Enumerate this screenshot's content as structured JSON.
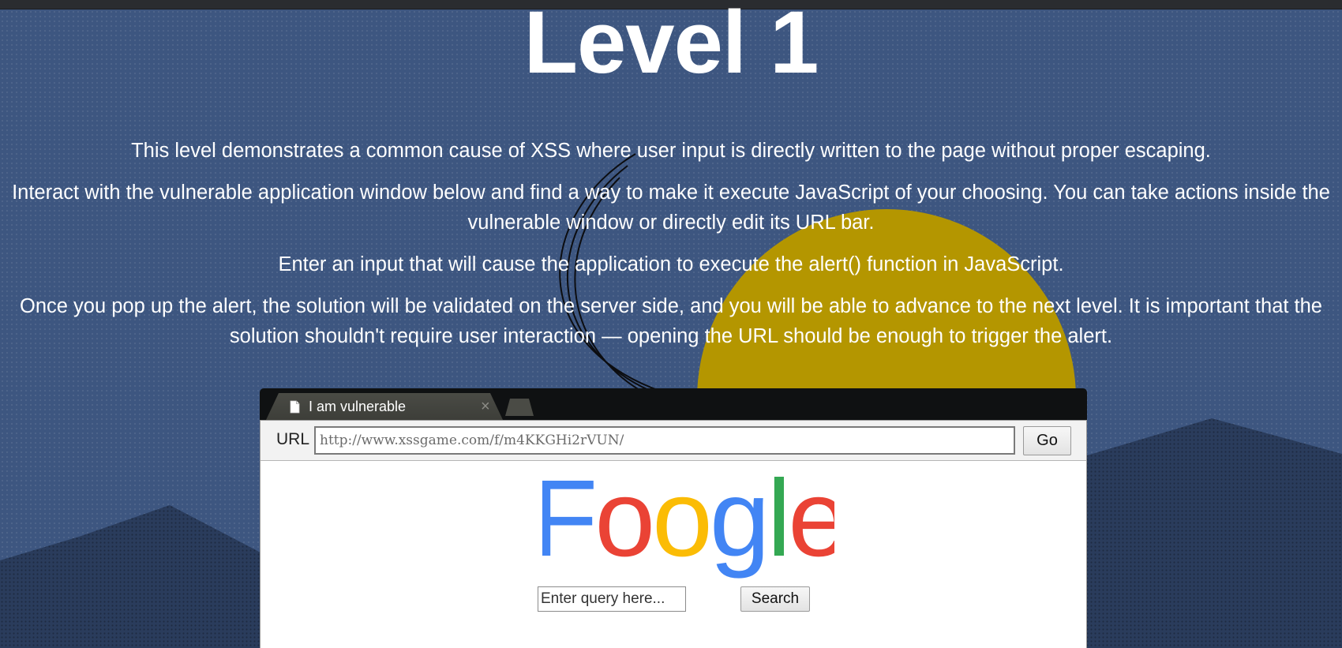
{
  "page": {
    "title": "Level 1",
    "paragraphs": [
      "This level demonstrates a common cause of XSS where user input is directly written to the page without proper escaping.",
      "Interact with the vulnerable application window below and find a way to make it execute JavaScript of your choosing. You can take actions inside the vulnerable window or directly edit its URL bar.",
      "Enter an input that will cause the application to execute the alert() function in JavaScript.",
      "Once you pop up the alert, the solution will be validated on the server side, and you will be able to advance to the next level. It is important that the solution shouldn't require user interaction — opening the URL should be enough to trigger the alert."
    ]
  },
  "browser": {
    "tab_title": "I am vulnerable",
    "tab_close": "×",
    "url_label": "URL",
    "url_value": "http://www.xssgame.com/f/m4KKGHi2rVUN/",
    "go_label": "Go"
  },
  "app": {
    "logo_text": "Foogle",
    "logo_colors": [
      "#4285f4",
      "#ea4335",
      "#fbbc05",
      "#4285f4",
      "#34a853",
      "#ea4335"
    ],
    "query_placeholder": "Enter query here...",
    "search_label": "Search"
  },
  "colors": {
    "background": "#3d5680",
    "sun": "#b49600",
    "mountains": "#2a3c5c"
  },
  "icons": {
    "tab_icon": "document-icon",
    "close_icon": "close-icon"
  }
}
